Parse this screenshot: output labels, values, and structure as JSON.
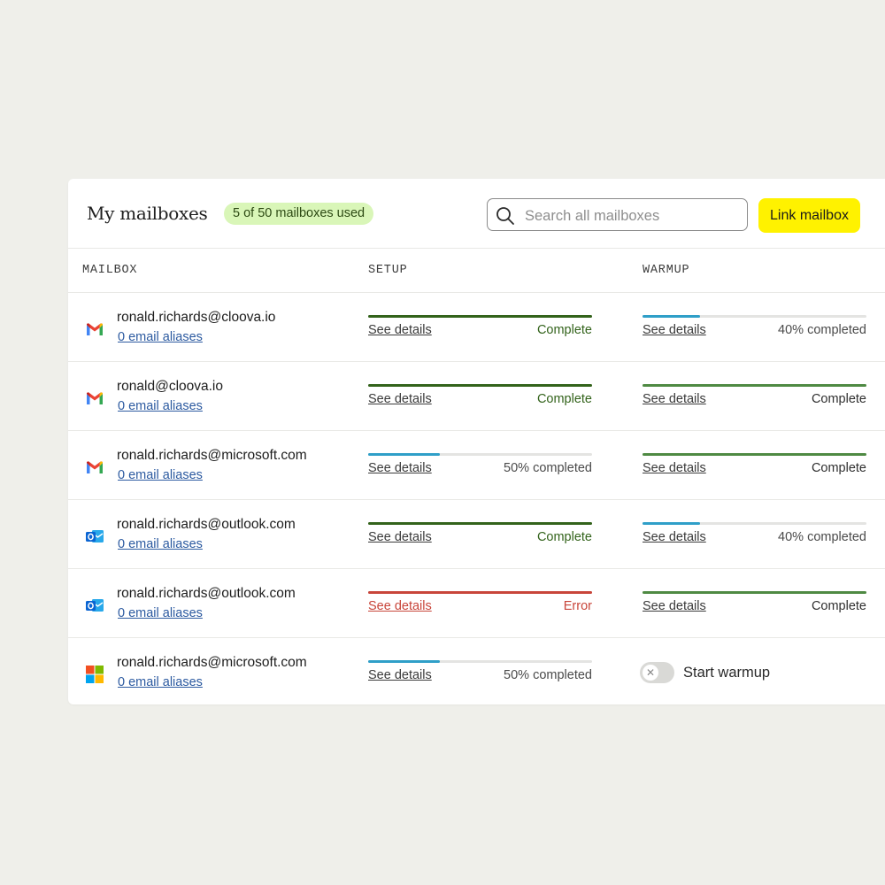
{
  "header": {
    "title": "My mailboxes",
    "usage_badge": "5 of 50 mailboxes used",
    "search_placeholder": "Search all mailboxes",
    "link_button": "Link mailbox"
  },
  "columns": {
    "mailbox": "MAILBOX",
    "setup": "SETUP",
    "warmup": "WARMUP"
  },
  "colors": {
    "accent_yellow": "#fff200",
    "badge_bg": "#d9f6b8",
    "complete_green": "#33631b",
    "warmup_complete_green": "#4f8a43",
    "progress_blue": "#2f9fc8",
    "error_red": "#c8453a"
  },
  "rows": [
    {
      "provider": "gmail-icon",
      "email": "ronald.richards@cloova.io",
      "aliases": "0 email aliases",
      "setup": {
        "details": "See details",
        "status": "Complete",
        "state": "complete",
        "progress": 1.0
      },
      "warmup": {
        "details": "See details",
        "status": "40% completed",
        "state": "progress",
        "progress": 0.4
      }
    },
    {
      "provider": "gmail-icon",
      "email": "ronald@cloova.io",
      "aliases": "0 email aliases",
      "setup": {
        "details": "See details",
        "status": "Complete",
        "state": "complete",
        "progress": 1.0
      },
      "warmup": {
        "details": "See details",
        "status": "Complete",
        "state": "complete",
        "progress": 1.0
      }
    },
    {
      "provider": "gmail-icon",
      "email": "ronald.richards@microsoft.com",
      "aliases": "0 email aliases",
      "setup": {
        "details": "See details",
        "status": "50% completed",
        "state": "progress",
        "progress": 0.5
      },
      "warmup": {
        "details": "See details",
        "status": "Complete",
        "state": "complete",
        "progress": 1.0
      }
    },
    {
      "provider": "outlook-icon",
      "email": "ronald.richards@outlook.com",
      "aliases": "0 email aliases",
      "setup": {
        "details": "See details",
        "status": "Complete",
        "state": "complete",
        "progress": 1.0
      },
      "warmup": {
        "details": "See details",
        "status": "40% completed",
        "state": "progress",
        "progress": 0.4
      }
    },
    {
      "provider": "outlook-icon",
      "email": "ronald.richards@outlook.com",
      "aliases": "0 email aliases",
      "setup": {
        "details": "See details",
        "status": "Error",
        "state": "error",
        "progress": 1.0
      },
      "warmup": {
        "details": "See details",
        "status": "Complete",
        "state": "complete",
        "progress": 1.0
      }
    },
    {
      "provider": "microsoft-icon",
      "email": "ronald.richards@microsoft.com",
      "aliases": "0 email aliases",
      "setup": {
        "details": "See details",
        "status": "50% completed",
        "state": "progress",
        "progress": 0.5
      },
      "warmup_toggle": {
        "label": "Start warmup",
        "enabled": false
      }
    }
  ]
}
